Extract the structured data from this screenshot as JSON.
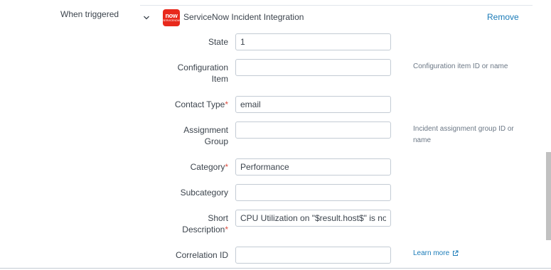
{
  "trigger": {
    "label": "When triggered"
  },
  "integration": {
    "title": "ServiceNow Incident Integration",
    "logo_text": "now",
    "logo_subtext": "SERVICENOW",
    "remove_label": "Remove"
  },
  "fields": {
    "state": {
      "label": "State",
      "value": "1",
      "required": false
    },
    "configuration_item": {
      "label_line1": "Configuration",
      "label_line2": "Item",
      "value": "",
      "required": false,
      "hint": "Configuration item ID or name"
    },
    "contact_type": {
      "label": "Contact Type",
      "value": "email",
      "required": true
    },
    "assignment_group": {
      "label_line1": "Assignment",
      "label_line2": "Group",
      "value": "",
      "required": false,
      "hint": "Incident assignment group ID or name"
    },
    "category": {
      "label": "Category",
      "value": "Performance",
      "required": true
    },
    "subcategory": {
      "label": "Subcategory",
      "value": "",
      "required": false
    },
    "short_description": {
      "label_line1": "Short",
      "label_line2": "Description",
      "value": "CPU Utilization on \"$result.host$\" is no",
      "required": true
    },
    "correlation_id": {
      "label": "Correlation ID",
      "value": "",
      "required": false,
      "help_link": "Learn more"
    }
  },
  "required_marker": "*",
  "icons": {
    "expand": "chevron-down-icon",
    "external": "external-link-icon",
    "logo": "servicenow-logo"
  },
  "colors": {
    "link": "#1a7bb8",
    "required": "#dc4e41",
    "logo_bg": "#e8291c",
    "text": "#3c444d",
    "border": "#c3cbd4"
  }
}
